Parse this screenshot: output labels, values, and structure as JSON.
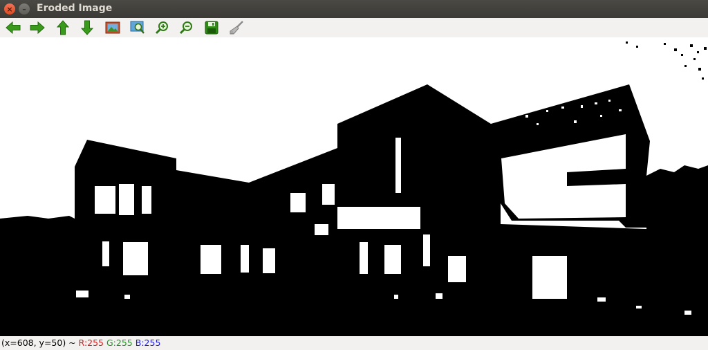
{
  "window": {
    "title": "Eroded Image",
    "close_glyph": "×",
    "minimize_glyph": "–"
  },
  "toolbar": {
    "buttons": [
      {
        "name": "pan-left",
        "icon": "arrow-left-icon"
      },
      {
        "name": "pan-right",
        "icon": "arrow-right-icon"
      },
      {
        "name": "pan-up",
        "icon": "arrow-up-icon"
      },
      {
        "name": "pan-down",
        "icon": "arrow-down-icon"
      },
      {
        "name": "zoom-original",
        "icon": "image-icon"
      },
      {
        "name": "zoom-fit",
        "icon": "zoom-area-icon"
      },
      {
        "name": "zoom-in",
        "icon": "zoom-in-icon"
      },
      {
        "name": "zoom-out",
        "icon": "zoom-out-icon"
      },
      {
        "name": "save",
        "icon": "save-icon"
      },
      {
        "name": "properties",
        "icon": "brush-icon"
      }
    ],
    "colors": {
      "arrow": "#3a9a1c",
      "save": "#2f8a16"
    }
  },
  "image": {
    "description_icon": "eroded-binary-image",
    "colors": {
      "foreground": "#000000",
      "background": "#ffffff"
    }
  },
  "status": {
    "coords": "(x=608, y=50) ~",
    "r": "R:255",
    "g": "G:255",
    "b": "B:255"
  }
}
